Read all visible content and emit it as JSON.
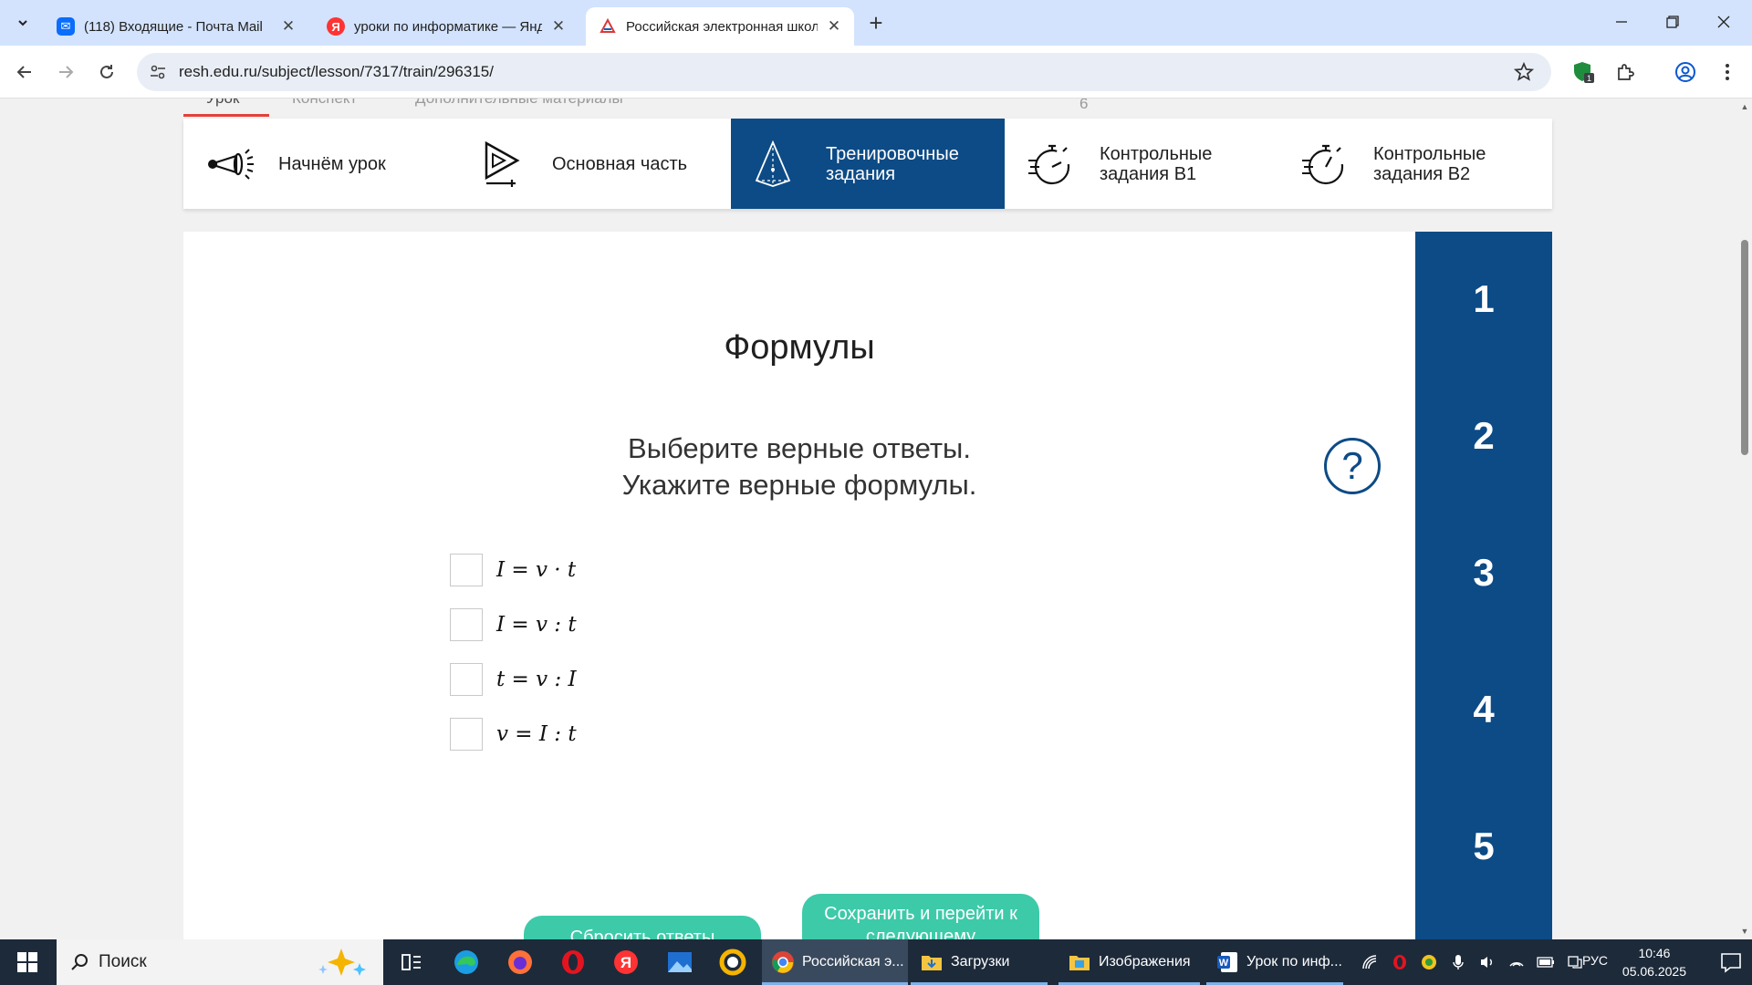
{
  "browser": {
    "tabs": [
      {
        "title": "(118) Входящие - Почта Mail",
        "active": false,
        "favicon": "mail-icon",
        "color": "#0a6dfb"
      },
      {
        "title": "уроки по информатике — Янд",
        "active": false,
        "favicon": "yandex-icon",
        "color": "#f33"
      },
      {
        "title": "Российская электронная школ",
        "active": true,
        "favicon": "resh-icon",
        "color": "#d93a3a"
      }
    ],
    "url": "resh.edu.ru/subject/lesson/7317/train/296315/",
    "extension_badge": "1"
  },
  "page": {
    "sub_tabs": [
      "Урок",
      "Конспект",
      "Дополнительные материалы",
      "6"
    ],
    "nav": [
      {
        "label": "Начнём урок",
        "icon": "megaphone-icon",
        "active": false
      },
      {
        "label": "Основная часть",
        "icon": "play-icon",
        "active": false
      },
      {
        "label": "Тренировочные задания",
        "icon": "pyramid-icon",
        "active": true
      },
      {
        "label": "Контрольные задания В1",
        "icon": "stopwatch-icon",
        "active": false
      },
      {
        "label": "Контрольные задания В2",
        "icon": "stopwatch-icon",
        "active": false
      }
    ],
    "task": {
      "title": "Формулы",
      "instruction_line1": "Выберите верные ответы.",
      "instruction_line2": "Укажите верные формулы.",
      "help": "?",
      "options": [
        "I = v · t",
        "I = v : t",
        "t = v : I",
        "v = I : t"
      ]
    },
    "buttons": {
      "reset": "Сбросить ответы",
      "save_next_line1": "Сохранить и перейти к",
      "save_next_line2": "следующему"
    },
    "task_numbers": [
      "1",
      "2",
      "3",
      "4",
      "5"
    ],
    "colors": {
      "brand_blue": "#0d4b86",
      "accent_green": "#3dcaa9",
      "underline_red": "#e2413a"
    }
  },
  "taskbar": {
    "search_placeholder": "Поиск",
    "apps": [
      {
        "label": "Российская э...",
        "icon": "chrome-icon"
      },
      {
        "label": "Загрузки",
        "icon": "folder-icon"
      },
      {
        "label": "Изображения",
        "icon": "folder-icon"
      },
      {
        "label": "Урок по инф...",
        "icon": "word-icon"
      }
    ],
    "lang": "РУС",
    "time": "10:46",
    "date": "05.06.2025"
  }
}
